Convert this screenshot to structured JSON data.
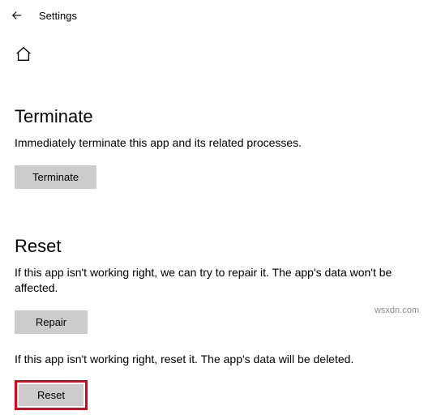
{
  "header": {
    "title": "Settings"
  },
  "sections": {
    "terminate": {
      "heading": "Terminate",
      "description": "Immediately terminate this app and its related processes.",
      "button": "Terminate"
    },
    "reset": {
      "heading": "Reset",
      "repair_description": "If this app isn't working right, we can try to repair it. The app's data won't be affected.",
      "repair_button": "Repair",
      "reset_description": "If this app isn't working right, reset it. The app's data will be deleted.",
      "reset_button": "Reset"
    }
  },
  "watermark": "wsxdn.com"
}
